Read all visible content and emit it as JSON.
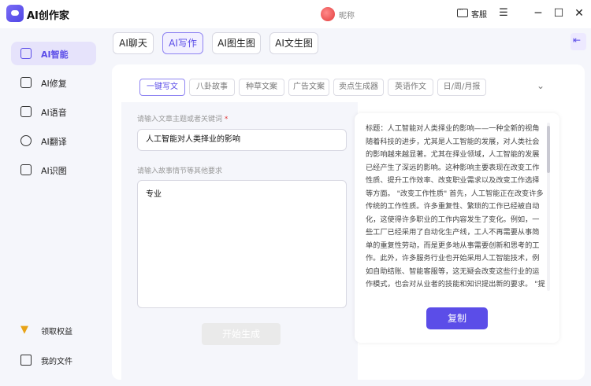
{
  "app": {
    "title": "AI创作家"
  },
  "user": {
    "name": "昵称"
  },
  "titlebar": {
    "service_label": "客服"
  },
  "colors": {
    "accent": "#5b4de8",
    "accent_bg": "#e6e3fb",
    "required_mark": "#e23b3b"
  },
  "sidebar": {
    "items": [
      {
        "label": "AI智能",
        "icon": "ai-smart-icon",
        "active": true
      },
      {
        "label": "AI修复",
        "icon": "ai-repair-icon"
      },
      {
        "label": "AI语音",
        "icon": "ai-voice-icon"
      },
      {
        "label": "AI翻译",
        "icon": "ai-translate-icon"
      },
      {
        "label": "AI识图",
        "icon": "ai-image-recognition-icon"
      }
    ],
    "bottom": [
      {
        "label": "领取权益",
        "icon": "gift-icon"
      },
      {
        "label": "我的文件",
        "icon": "folder-icon"
      }
    ]
  },
  "top_tabs": [
    {
      "label": "AI聊天"
    },
    {
      "label": "AI写作",
      "active": true
    },
    {
      "label": "AI图生图"
    },
    {
      "label": "AI文生图"
    }
  ],
  "sub_tabs": [
    {
      "label": "一键写文",
      "active": true
    },
    {
      "label": "八卦故事"
    },
    {
      "label": "种草文案"
    },
    {
      "label": "广告文案"
    },
    {
      "label": "卖点生成器"
    },
    {
      "label": "英语作文"
    },
    {
      "label": "日/周/月报"
    }
  ],
  "form": {
    "topic_label": "请输入文章主题或者关键词",
    "topic_required": "*",
    "topic_value": "人工智能对人类择业的影响",
    "req_label": "请输入故事情节等其他要求",
    "req_value": "专业",
    "generate_label": "开始生成"
  },
  "output": {
    "text": "标题：人工智能对人类择业的影响——一种全新的视角 随着科技的进步，尤其是人工智能的发展，对人类社会的影响越来越显著。尤其在择业领域，人工智能的发展已经产生了深远的影响。这种影响主要表现在改变工作性质、提升工作效率、改变职业需求以及改变工作选择等方面。 \"改变工作性质\" 首先，人工智能正在改变许多传统的工作性质。许多重复性、繁琐的工作已经被自动化，这使得许多职业的工作内容发生了变化。例如，一些工厂已经采用了自动化生产线，工人不再需要从事简单的重复性劳动，而是更多地从事需要创新和思考的工作。此外，许多服务行业也开始采用人工智能技术，例如自助结账、智能客服等，这无疑会改变这些行业的运作模式，也会对从业者的技能和知识提出新的要求。 \"提升工作效率\" 其次，人工智能的使用可以显著提升工作效率。在一些需要大量数据分析、处理的工",
    "copy_label": "复制"
  }
}
